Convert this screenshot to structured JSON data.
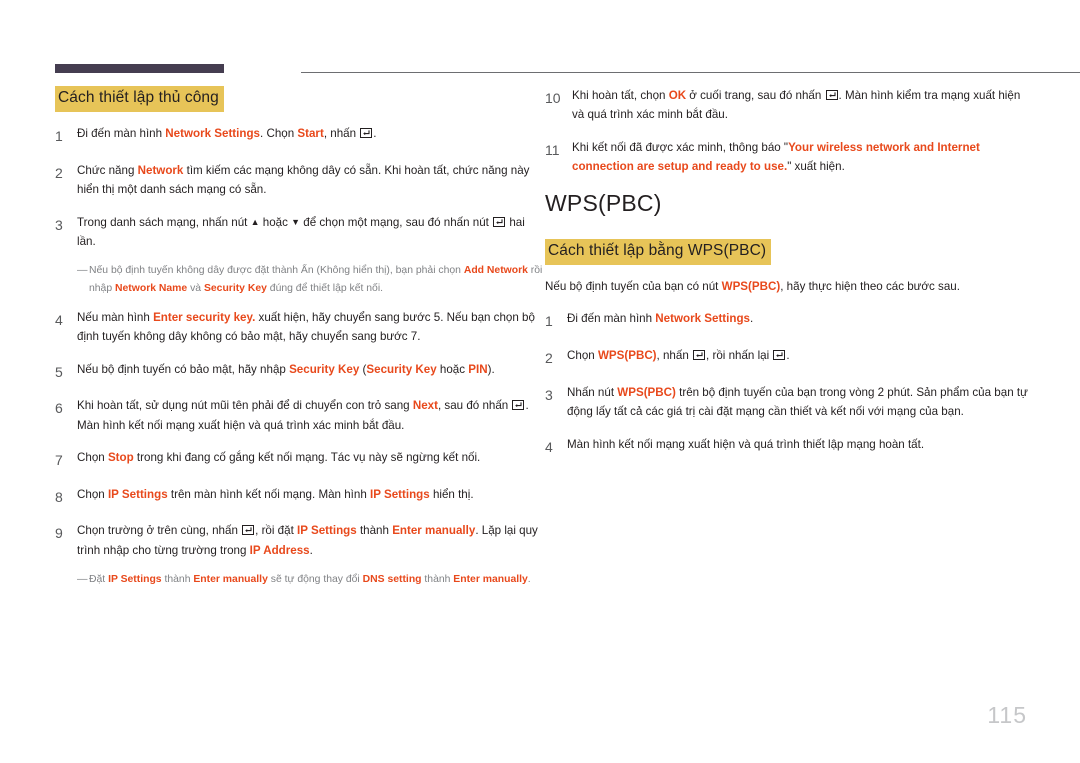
{
  "page": {
    "number": "115",
    "accent_color": "#e8491c",
    "highlight_color": "#e7c458",
    "header_bar_color": "#453d50",
    "note_color": "#808285"
  },
  "left_column": {
    "heading": "Cách thiết lập thủ công",
    "steps": [
      {
        "num": "1",
        "parts": [
          {
            "t": "text",
            "v": "Đi đến màn hình "
          },
          {
            "t": "accent",
            "v": "Network Settings"
          },
          {
            "t": "text",
            "v": ". Chọn "
          },
          {
            "t": "accent",
            "v": "Start"
          },
          {
            "t": "text",
            "v": ", nhấn "
          },
          {
            "t": "key",
            "v": "enter-key-icon"
          },
          {
            "t": "text",
            "v": "."
          }
        ]
      },
      {
        "num": "2",
        "parts": [
          {
            "t": "text",
            "v": "Chức năng "
          },
          {
            "t": "accent",
            "v": "Network"
          },
          {
            "t": "text",
            "v": " tìm kiếm các mạng không dây có sẵn. Khi hoàn tất, chức năng này hiển thị một danh sách mạng có sẵn."
          }
        ]
      },
      {
        "num": "3",
        "parts": [
          {
            "t": "text",
            "v": "Trong danh sách mạng, nhấn nút "
          },
          {
            "t": "glyph",
            "v": "▲"
          },
          {
            "t": "text",
            "v": " hoặc "
          },
          {
            "t": "glyph",
            "v": "▼"
          },
          {
            "t": "text",
            "v": " để chọn một mạng, sau đó nhấn nút "
          },
          {
            "t": "key",
            "v": "enter-key-icon"
          },
          {
            "t": "text",
            "v": " hai lần."
          }
        ]
      },
      {
        "num": "4",
        "parts": [
          {
            "t": "text",
            "v": "Nếu màn hình "
          },
          {
            "t": "accent",
            "v": "Enter security key."
          },
          {
            "t": "text",
            "v": " xuất hiện, hãy chuyển sang bước 5. Nếu bạn chọn bộ định tuyến không dây không có bảo mật, hãy chuyển sang bước 7."
          }
        ]
      },
      {
        "num": "5",
        "parts": [
          {
            "t": "text",
            "v": "Nếu bộ định tuyến có bảo mật, hãy nhập "
          },
          {
            "t": "accent",
            "v": "Security Key"
          },
          {
            "t": "text",
            "v": " ("
          },
          {
            "t": "accent",
            "v": "Security Key"
          },
          {
            "t": "text",
            "v": " hoặc "
          },
          {
            "t": "accent",
            "v": "PIN"
          },
          {
            "t": "text",
            "v": ")."
          }
        ]
      },
      {
        "num": "6",
        "parts": [
          {
            "t": "text",
            "v": "Khi hoàn tất, sử dụng nút mũi tên phải để di chuyển con trỏ sang "
          },
          {
            "t": "accent",
            "v": "Next"
          },
          {
            "t": "text",
            "v": ", sau đó nhấn "
          },
          {
            "t": "key",
            "v": "enter-key-icon"
          },
          {
            "t": "text",
            "v": ". Màn hình kết nối mạng xuất hiện và quá trình xác minh bắt đầu."
          }
        ]
      },
      {
        "num": "7",
        "parts": [
          {
            "t": "text",
            "v": "Chọn "
          },
          {
            "t": "accent",
            "v": "Stop"
          },
          {
            "t": "text",
            "v": " trong khi đang cố gắng kết nối mạng. Tác vụ này sẽ ngừng kết nối."
          }
        ]
      },
      {
        "num": "8",
        "parts": [
          {
            "t": "text",
            "v": "Chọn "
          },
          {
            "t": "accent",
            "v": "IP Settings"
          },
          {
            "t": "text",
            "v": " trên màn hình kết nối mạng. Màn hình "
          },
          {
            "t": "accent",
            "v": "IP Settings"
          },
          {
            "t": "text",
            "v": " hiển thị."
          }
        ]
      },
      {
        "num": "9",
        "parts": [
          {
            "t": "text",
            "v": "Chọn trường ở trên cùng, nhấn "
          },
          {
            "t": "key",
            "v": "enter-key-icon"
          },
          {
            "t": "text",
            "v": ", rồi đặt "
          },
          {
            "t": "accent",
            "v": "IP Settings"
          },
          {
            "t": "text",
            "v": " thành "
          },
          {
            "t": "accent",
            "v": "Enter manually"
          },
          {
            "t": "text",
            "v": ". Lặp lại quy trình nhập cho từng trường trong "
          },
          {
            "t": "accent",
            "v": "IP Address"
          },
          {
            "t": "text",
            "v": "."
          }
        ]
      }
    ],
    "note_after_step3": {
      "dash": "―",
      "parts": [
        {
          "t": "text",
          "v": "Nếu bộ định tuyến không dây được đặt thành Ẩn (Không hiển thị), bạn phải chọn "
        },
        {
          "t": "accent",
          "v": "Add Network"
        },
        {
          "t": "text",
          "v": " rồi nhập "
        },
        {
          "t": "accent",
          "v": "Network Name"
        },
        {
          "t": "text",
          "v": " và "
        },
        {
          "t": "accent",
          "v": "Security Key"
        },
        {
          "t": "text",
          "v": " đúng để thiết lập kết nối."
        }
      ]
    },
    "note_after_step9": {
      "dash": "―",
      "parts": [
        {
          "t": "text",
          "v": "Đặt "
        },
        {
          "t": "accent",
          "v": "IP Settings"
        },
        {
          "t": "text",
          "v": " thành "
        },
        {
          "t": "accent",
          "v": "Enter manually"
        },
        {
          "t": "text",
          "v": " sẽ tự động thay đổi "
        },
        {
          "t": "accent",
          "v": "DNS setting"
        },
        {
          "t": "text",
          "v": " thành "
        },
        {
          "t": "accent",
          "v": "Enter manually"
        },
        {
          "t": "text",
          "v": "."
        }
      ]
    }
  },
  "right_column": {
    "steps_continued": [
      {
        "num": "10",
        "parts": [
          {
            "t": "text",
            "v": "Khi hoàn tất, chọn "
          },
          {
            "t": "accent",
            "v": "OK"
          },
          {
            "t": "text",
            "v": " ở cuối trang, sau đó nhấn "
          },
          {
            "t": "key",
            "v": "enter-key-icon"
          },
          {
            "t": "text",
            "v": ". Màn hình kiểm tra mạng xuất hiện và quá trình xác minh bắt đầu."
          }
        ]
      },
      {
        "num": "11",
        "parts": [
          {
            "t": "text",
            "v": "Khi kết nối đã được xác minh, thông báo \""
          },
          {
            "t": "accent",
            "v": "Your wireless network and Internet connection are setup and ready to use."
          },
          {
            "t": "text",
            "v": "\" xuất hiện."
          }
        ]
      }
    ],
    "section_title": "WPS(PBC)",
    "heading": "Cách thiết lập bằng WPS(PBC)",
    "intro": [
      {
        "t": "text",
        "v": "Nếu bộ định tuyến của bạn có nút "
      },
      {
        "t": "accent",
        "v": "WPS(PBC)"
      },
      {
        "t": "text",
        "v": ", hãy thực hiện theo các bước sau."
      }
    ],
    "steps": [
      {
        "num": "1",
        "parts": [
          {
            "t": "text",
            "v": "Đi đến màn hình "
          },
          {
            "t": "accent",
            "v": "Network Settings"
          },
          {
            "t": "text",
            "v": "."
          }
        ]
      },
      {
        "num": "2",
        "parts": [
          {
            "t": "text",
            "v": "Chọn "
          },
          {
            "t": "accent",
            "v": "WPS(PBC)"
          },
          {
            "t": "text",
            "v": ", nhấn "
          },
          {
            "t": "key",
            "v": "enter-key-icon"
          },
          {
            "t": "text",
            "v": ", rồi nhấn lại "
          },
          {
            "t": "key",
            "v": "enter-key-icon"
          },
          {
            "t": "text",
            "v": "."
          }
        ]
      },
      {
        "num": "3",
        "parts": [
          {
            "t": "text",
            "v": "Nhấn nút "
          },
          {
            "t": "accent",
            "v": "WPS(PBC)"
          },
          {
            "t": "text",
            "v": " trên bộ định tuyến của bạn trong vòng 2 phút. Sản phẩm của bạn tự động lấy tất cả các giá trị cài đặt mạng cần thiết và kết nối với mạng của bạn."
          }
        ]
      },
      {
        "num": "4",
        "parts": [
          {
            "t": "text",
            "v": "Màn hình kết nối mạng xuất hiện và quá trình thiết lập mạng hoàn tất."
          }
        ]
      }
    ]
  }
}
